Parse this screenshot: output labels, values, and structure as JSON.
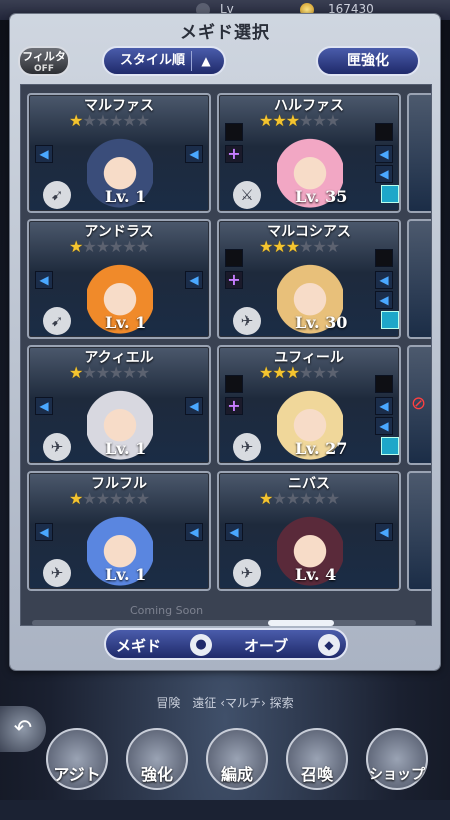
{
  "status": {
    "level_label": "Lv",
    "coins": "167430"
  },
  "dialog": {
    "title": "メギド選択",
    "filter_label": "フィルタ",
    "filter_state": "OFF",
    "sort_label": "スタイル順",
    "sort_arrow": "▲",
    "boost_label": "匣強化",
    "coming_soon": "Coming Soon"
  },
  "cards": [
    {
      "name": "マルファス",
      "stars": 1,
      "level": "Lv. 1",
      "level_num": 1,
      "weapon_icon": "bow-icon"
    },
    {
      "name": "ハルファス",
      "stars": 3,
      "level": "Lv. 35",
      "level_num": 35,
      "weapon_icon": "sword-icon"
    },
    {
      "name": "アンドラス",
      "stars": 1,
      "level": "Lv. 1",
      "level_num": 1,
      "weapon_icon": "bow-icon"
    },
    {
      "name": "マルコシアス",
      "stars": 3,
      "level": "Lv. 30",
      "level_num": 30,
      "weapon_icon": "wing-icon"
    },
    {
      "name": "アクィエル",
      "stars": 1,
      "level": "Lv. 1",
      "level_num": 1,
      "weapon_icon": "wing-icon"
    },
    {
      "name": "ユフィール",
      "stars": 3,
      "level": "Lv. 27",
      "level_num": 27,
      "weapon_icon": "wing-icon"
    },
    {
      "name": "フルフル",
      "stars": 1,
      "level": "Lv. 1",
      "level_num": 1,
      "weapon_icon": "wing-icon"
    },
    {
      "name": "ニバス",
      "stars": 1,
      "level": "Lv. 4",
      "level_num": 4,
      "weapon_icon": "wing-icon"
    }
  ],
  "toggle": {
    "left_label": "メギド",
    "right_label": "オーブ"
  },
  "subnav": {
    "text": "冒険　遠征 ‹マルチ› 探索"
  },
  "nav": [
    {
      "label": "アジト"
    },
    {
      "label": "強化"
    },
    {
      "label": "編成"
    },
    {
      "label": "召喚"
    },
    {
      "label": "ショップ"
    }
  ],
  "colors": {
    "star_on": "#f4c430",
    "accent": "#2d3c8a",
    "slot_arrow": "#4aa8ff",
    "plus": "#c77dff"
  }
}
